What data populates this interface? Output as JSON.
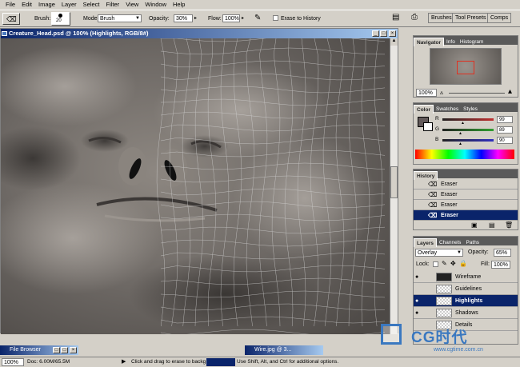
{
  "menu": [
    "File",
    "Edit",
    "Image",
    "Layer",
    "Select",
    "Filter",
    "View",
    "Window",
    "Help"
  ],
  "options": {
    "brush_label": "Brush:",
    "brush_size": "20",
    "mode_label": "Mode:",
    "mode_value": "Brush",
    "opacity_label": "Opacity:",
    "opacity_value": "30%",
    "flow_label": "Flow:",
    "flow_value": "100%",
    "erase_history_label": "Erase to History",
    "wells": [
      "Brushes",
      "Tool Presets",
      "Comps"
    ]
  },
  "document": {
    "title": "Creature_Head.psd @ 100% (Highlights, RGB/8#)"
  },
  "navigator": {
    "tabs": [
      "Navigator",
      "Info",
      "Histogram"
    ],
    "zoom": "100%"
  },
  "color": {
    "tabs": [
      "Color",
      "Swatches",
      "Styles"
    ],
    "channels": [
      {
        "label": "R",
        "value": "99",
        "level": 0.39
      },
      {
        "label": "G",
        "value": "89",
        "level": 0.35
      },
      {
        "label": "B",
        "value": "90",
        "level": 0.35
      }
    ]
  },
  "history": {
    "tabs": [
      "History"
    ],
    "items": [
      "Eraser",
      "Eraser",
      "Eraser",
      "Eraser"
    ]
  },
  "layers": {
    "tabs": [
      "Layers",
      "Channels",
      "Paths"
    ],
    "blend_mode": "Overlay",
    "opacity_label": "Opacity:",
    "opacity_value": "65%",
    "lock_label": "Lock:",
    "fill_label": "Fill:",
    "fill_value": "100%",
    "items": [
      "Wireframe",
      "Guidelines",
      "Highlights",
      "Shadows",
      "Details"
    ]
  },
  "taskbar": {
    "file_browser": "File Browser",
    "wire_doc": "Wire.jpg @ 3..."
  },
  "status": {
    "zoom": "100%",
    "doc_size": "Doc: 6.00M/65.5M",
    "hint_prefix": "Click and drag to erase to backg",
    "hint_suffix": "Use Shift, Alt, and Ctrl for additional options."
  },
  "watermark": {
    "brand": "CG时代",
    "url": "www.cgtime.com.cn"
  }
}
